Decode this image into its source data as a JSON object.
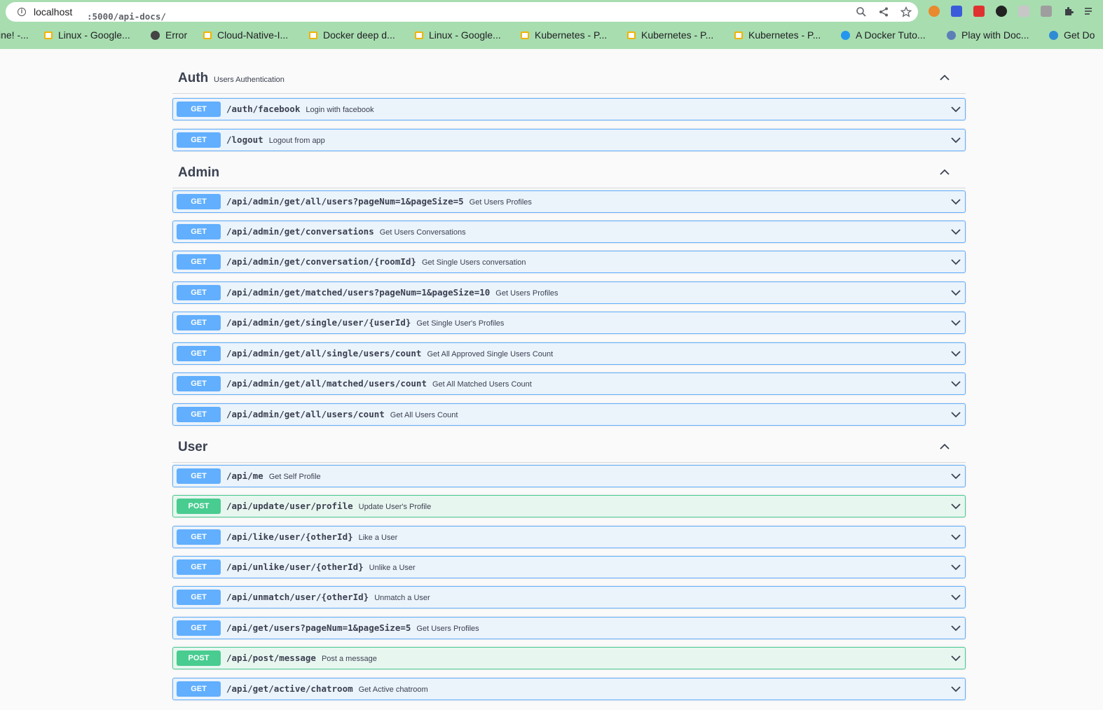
{
  "browser": {
    "url_host": "localhost",
    "url_path": ":5000/api-docs/",
    "bookmarks": [
      "ine! -...",
      "Linux - Google...",
      "Error",
      "Cloud-Native-I...",
      "Docker deep d...",
      "Linux - Google...",
      "Kubernetes - P...",
      "Kubernetes - P...",
      "Kubernetes - P...",
      "A Docker Tuto...",
      "Play with Doc...",
      "Get Do"
    ]
  },
  "sections": [
    {
      "title": "Auth",
      "description": "Users Authentication",
      "operations": [
        {
          "method": "GET",
          "path": "/auth/facebook",
          "summary": "Login with facebook"
        },
        {
          "method": "GET",
          "path": "/logout",
          "summary": "Logout from app"
        }
      ]
    },
    {
      "title": "Admin",
      "description": "",
      "operations": [
        {
          "method": "GET",
          "path": "/api/admin/get/all/users?pageNum=1&pageSize=5",
          "summary": "Get Users Profiles"
        },
        {
          "method": "GET",
          "path": "/api/admin/get/conversations",
          "summary": "Get Users Conversations"
        },
        {
          "method": "GET",
          "path": "/api/admin/get/conversation/{roomId}",
          "summary": "Get Single Users conversation"
        },
        {
          "method": "GET",
          "path": "/api/admin/get/matched/users?pageNum=1&pageSize=10",
          "summary": "Get Users Profiles"
        },
        {
          "method": "GET",
          "path": "/api/admin/get/single/user/{userId}",
          "summary": "Get Single User's Profiles"
        },
        {
          "method": "GET",
          "path": "/api/admin/get/all/single/users/count",
          "summary": "Get All Approved Single Users Count"
        },
        {
          "method": "GET",
          "path": "/api/admin/get/all/matched/users/count",
          "summary": "Get All Matched Users Count"
        },
        {
          "method": "GET",
          "path": "/api/admin/get/all/users/count",
          "summary": "Get All Users Count"
        }
      ]
    },
    {
      "title": "User",
      "description": "",
      "operations": [
        {
          "method": "GET",
          "path": "/api/me",
          "summary": "Get Self Profile"
        },
        {
          "method": "POST",
          "path": "/api/update/user/profile",
          "summary": "Update User's Profile"
        },
        {
          "method": "GET",
          "path": "/api/like/user/{otherId}",
          "summary": "Like a User"
        },
        {
          "method": "GET",
          "path": "/api/unlike/user/{otherId}",
          "summary": "Unlike a User"
        },
        {
          "method": "GET",
          "path": "/api/unmatch/user/{otherId}",
          "summary": "Unmatch a User"
        },
        {
          "method": "GET",
          "path": "/api/get/users?pageNum=1&pageSize=5",
          "summary": "Get Users Profiles"
        },
        {
          "method": "POST",
          "path": "/api/post/message",
          "summary": "Post a message"
        },
        {
          "method": "GET",
          "path": "/api/get/active/chatroom",
          "summary": "Get Active chatroom"
        }
      ]
    }
  ],
  "colors": {
    "get": "#61affe",
    "post": "#49cc90",
    "chrome": "#a8ddb0"
  }
}
